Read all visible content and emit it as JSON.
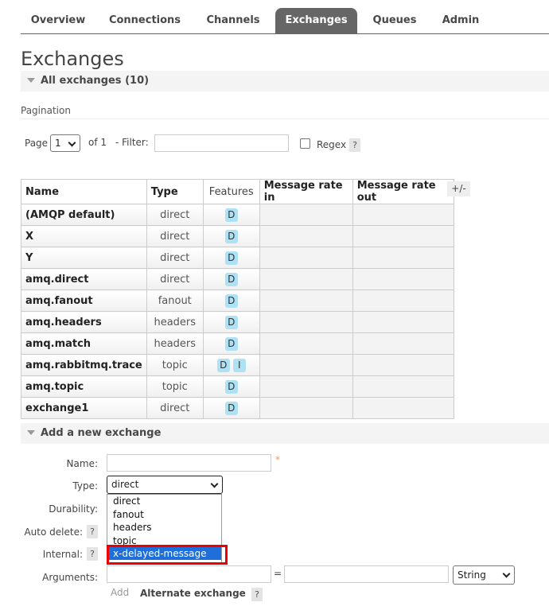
{
  "tabs": [
    "Overview",
    "Connections",
    "Channels",
    "Exchanges",
    "Queues",
    "Admin"
  ],
  "active_tab": "Exchanges",
  "page_title": "Exchanges",
  "all_exchanges_label": "All exchanges (10)",
  "pagination": {
    "section_label": "Pagination",
    "page_label": "Page",
    "page_value": "1",
    "of_label": "of 1",
    "filter_label": "- Filter:",
    "filter_value": "",
    "regex_label": "Regex",
    "help": "?"
  },
  "table": {
    "headers": [
      "Name",
      "Type",
      "Features",
      "Message rate in",
      "Message rate out"
    ],
    "plusminus": "+/-",
    "rows": [
      {
        "name": "(AMQP default)",
        "type": "direct",
        "features": [
          "D"
        ],
        "rate_in": "",
        "rate_out": ""
      },
      {
        "name": "X",
        "type": "direct",
        "features": [
          "D"
        ],
        "rate_in": "",
        "rate_out": ""
      },
      {
        "name": "Y",
        "type": "direct",
        "features": [
          "D"
        ],
        "rate_in": "",
        "rate_out": ""
      },
      {
        "name": "amq.direct",
        "type": "direct",
        "features": [
          "D"
        ],
        "rate_in": "",
        "rate_out": ""
      },
      {
        "name": "amq.fanout",
        "type": "fanout",
        "features": [
          "D"
        ],
        "rate_in": "",
        "rate_out": ""
      },
      {
        "name": "amq.headers",
        "type": "headers",
        "features": [
          "D"
        ],
        "rate_in": "",
        "rate_out": ""
      },
      {
        "name": "amq.match",
        "type": "headers",
        "features": [
          "D"
        ],
        "rate_in": "",
        "rate_out": ""
      },
      {
        "name": "amq.rabbitmq.trace",
        "type": "topic",
        "features": [
          "D",
          "I"
        ],
        "rate_in": "",
        "rate_out": ""
      },
      {
        "name": "amq.topic",
        "type": "topic",
        "features": [
          "D"
        ],
        "rate_in": "",
        "rate_out": ""
      },
      {
        "name": "exchange1",
        "type": "direct",
        "features": [
          "D"
        ],
        "rate_in": "",
        "rate_out": ""
      }
    ]
  },
  "add_exchange": {
    "section_label": "Add a new exchange",
    "name_label": "Name:",
    "name_value": "",
    "required_mark": "*",
    "type_label": "Type:",
    "type_value": "direct",
    "type_options": [
      "direct",
      "fanout",
      "headers",
      "topic",
      "x-delayed-message"
    ],
    "highlighted_option": "x-delayed-message",
    "durability_label": "Durability:",
    "auto_delete_label": "Auto delete:",
    "internal_label": "Internal:",
    "arguments_label": "Arguments:",
    "arg_key": "",
    "equals": "=",
    "arg_value": "",
    "arg_type": "String",
    "add_label": "Add",
    "alternate_exchange_label": "Alternate exchange",
    "help": "?"
  },
  "colors": {
    "active_tab_bg": "#666666",
    "badge_bg": "#aee1f4",
    "highlight_bg": "#1e6fd9",
    "annotation_border": "#e00000",
    "required": "#ee9966"
  }
}
